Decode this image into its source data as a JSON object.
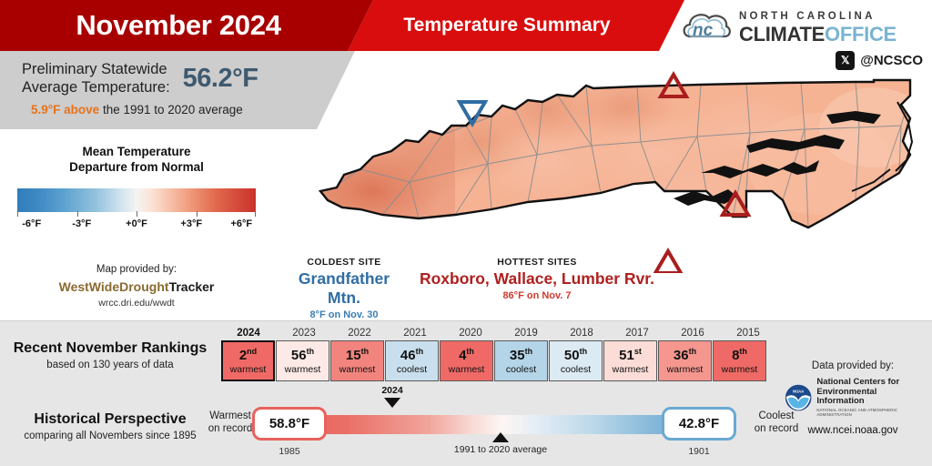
{
  "header": {
    "title": "November 2024",
    "subtitle": "Temperature Summary"
  },
  "logo": {
    "line1": "NORTH CAROLINA",
    "line2a": "CLIMATE",
    "line2b": "OFFICE",
    "x_icon": "x-logo-icon",
    "handle": "@NCSCO"
  },
  "summary": {
    "label": "Preliminary Statewide\nAverage Temperature:",
    "label_line1": "Preliminary Statewide",
    "label_line2": "Average Temperature:",
    "value": "56.2°F",
    "departure_amount": "5.9°F above",
    "departure_rest": " the 1991 to 2020 average",
    "value_color": "#3e5a70",
    "departure_color": "#e8731a"
  },
  "legend": {
    "title_line1": "Mean Temperature",
    "title_line2": "Departure from Normal",
    "ticks": [
      "-6°F",
      "-3°F",
      "+0°F",
      "+3°F",
      "+6°F"
    ],
    "tick_positions": [
      0,
      25,
      50,
      75,
      100
    ],
    "scale_min": -6,
    "scale_max": 6,
    "color_cold": "#2f7ebc",
    "color_mid": "#f4f4f2",
    "color_warm": "#c9312c",
    "credit_line1": "Map provided by:",
    "credit_brand_a": "WestWideDrought",
    "credit_brand_b": "Tracker",
    "credit_url": "wrcc.dri.edu/wwdt"
  },
  "map": {
    "coldest": {
      "kind": "COLDEST SITE",
      "name": "Grandfather Mtn.",
      "detail": "8°F on Nov. 30",
      "marker": "down-triangle-marker",
      "color": "#2f6da3"
    },
    "hottest": {
      "kind": "HOTTEST SITES",
      "name": "Roxboro, Wallace, Lumber Rvr.",
      "detail": "86°F on Nov. 7",
      "marker": "up-triangle-marker",
      "color": "#b01f1f"
    }
  },
  "rankings": {
    "title": "Recent November Rankings",
    "subtitle": "based on 130 years of data",
    "items": [
      {
        "year": "2024",
        "rank": "2",
        "suffix": "nd",
        "word": "warmest",
        "color": "#ef6a66",
        "current": true
      },
      {
        "year": "2023",
        "rank": "56",
        "suffix": "th",
        "word": "warmest",
        "color": "#fdeae6",
        "current": false
      },
      {
        "year": "2022",
        "rank": "15",
        "suffix": "th",
        "word": "warmest",
        "color": "#f2847e",
        "current": false
      },
      {
        "year": "2021",
        "rank": "46",
        "suffix": "th",
        "word": "coolest",
        "color": "#c9dfed",
        "current": false
      },
      {
        "year": "2020",
        "rank": "4",
        "suffix": "th",
        "word": "warmest",
        "color": "#ef6a66",
        "current": false
      },
      {
        "year": "2019",
        "rank": "35",
        "suffix": "th",
        "word": "coolest",
        "color": "#b4d4e8",
        "current": false
      },
      {
        "year": "2018",
        "rank": "50",
        "suffix": "th",
        "word": "coolest",
        "color": "#dceaf3",
        "current": false
      },
      {
        "year": "2017",
        "rank": "51",
        "suffix": "st",
        "word": "warmest",
        "color": "#fbdcd7",
        "current": false
      },
      {
        "year": "2016",
        "rank": "36",
        "suffix": "th",
        "word": "warmest",
        "color": "#f5968f",
        "current": false
      },
      {
        "year": "2015",
        "rank": "8",
        "suffix": "th",
        "word": "warmest",
        "color": "#ef6a66",
        "current": false
      }
    ]
  },
  "historical": {
    "title": "Historical Perspective",
    "subtitle": "comparing all Novembers since 1895",
    "warmest_label_l1": "Warmest",
    "warmest_label_l2": "on record",
    "warmest_value": "58.8°F",
    "warmest_year": "1985",
    "coolest_label_l1": "Coolest",
    "coolest_label_l2": "on record",
    "coolest_value": "42.8°F",
    "coolest_year": "1901",
    "current_marker": "2024",
    "average_marker": "1991 to 2020 average",
    "warm_color": "#e8625c",
    "cool_color": "#6aa9d1"
  },
  "noaa": {
    "provided_by": "Data provided by:",
    "agency_l1": "National Centers for",
    "agency_l2": "Environmental Information",
    "agency_l3": "NATIONAL OCEANIC AND ATMOSPHERIC ADMINISTRATION",
    "url": "www.ncei.noaa.gov",
    "seal": "noaa-seal-icon"
  }
}
